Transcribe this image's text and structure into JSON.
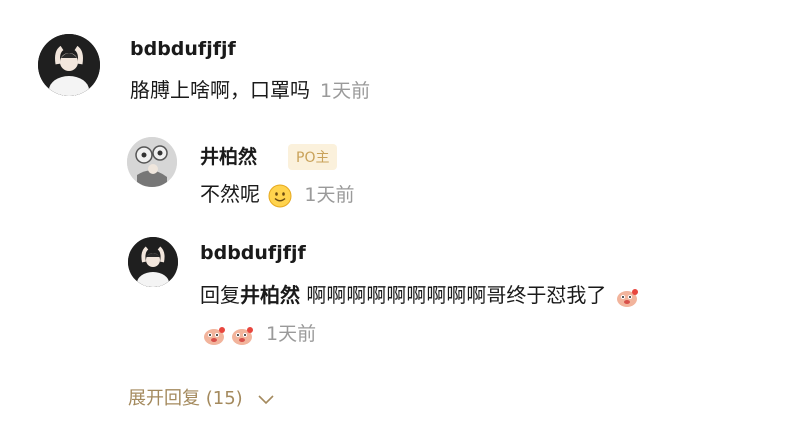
{
  "comment": {
    "username": "bdbdufjfjf",
    "text": "胳膊上啥啊，口罩吗",
    "time": "1天前"
  },
  "replies": [
    {
      "username": "井柏然",
      "badge": "PO主",
      "text": "不然呢",
      "emoji": "smile-emoji-icon",
      "time": "1天前"
    },
    {
      "username": "bdbdufjfjf",
      "reply_prefix": "回复",
      "reply_to": "井柏然",
      "text_line1": "啊啊啊啊啊啊啊啊啊哥终于怼我了",
      "emoji": "red-sticker-emoji-icon",
      "time": "1天前"
    }
  ],
  "expand": {
    "label": "展开回复 (15)"
  },
  "colors": {
    "badge_bg": "#fbf1dc",
    "badge_text": "#c9a25a",
    "expand_text": "#a48a5e",
    "time_text": "#9a9a9a"
  }
}
